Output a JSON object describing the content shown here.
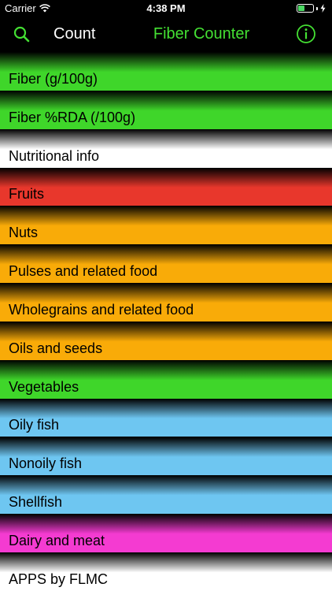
{
  "status_bar": {
    "carrier": "Carrier",
    "time": "4:38 PM",
    "battery_level": 0.45
  },
  "nav": {
    "count_label": "Count",
    "title": "Fiber Counter",
    "title_color": "#44e033",
    "search_icon": "search-icon",
    "info_icon": "info-icon"
  },
  "list": {
    "rows": [
      {
        "label": "Fiber (g/100g)",
        "color": "#3fd62a"
      },
      {
        "label": "Fiber %RDA (/100g)",
        "color": "#3fd62a"
      },
      {
        "label": "Nutritional info",
        "color": "#ffffff"
      },
      {
        "label": "Fruits",
        "color": "#e8372c"
      },
      {
        "label": "Nuts",
        "color": "#f9ab08"
      },
      {
        "label": "Pulses and related food",
        "color": "#f9ab08"
      },
      {
        "label": "Wholegrains and related food",
        "color": "#f9ab08"
      },
      {
        "label": "Oils and seeds",
        "color": "#f9ab08"
      },
      {
        "label": "Vegetables",
        "color": "#3fd62a"
      },
      {
        "label": "Oily fish",
        "color": "#6ec6f1"
      },
      {
        "label": "Nonoily fish",
        "color": "#6ec6f1"
      },
      {
        "label": "Shellfish",
        "color": "#6ec6f1"
      },
      {
        "label": "Dairy and meat",
        "color": "#f43bd1"
      },
      {
        "label": "APPS by FLMC",
        "color": "#ffffff"
      }
    ]
  }
}
